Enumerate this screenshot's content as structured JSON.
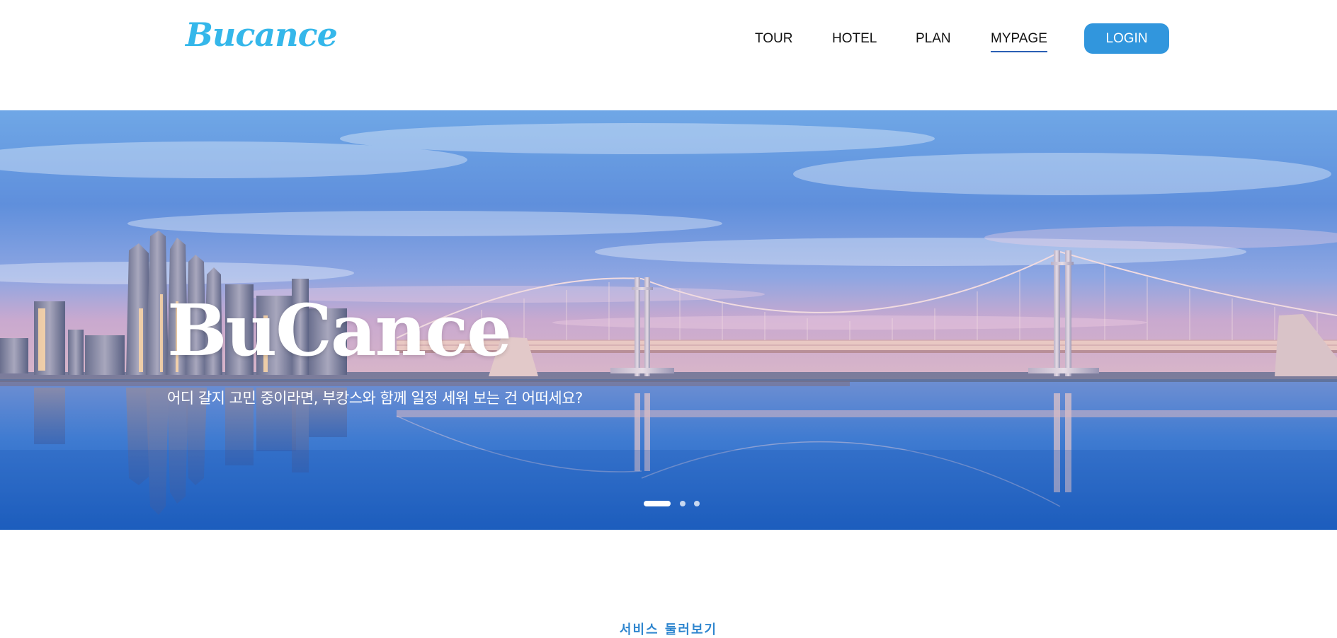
{
  "header": {
    "logo": "Bucance",
    "nav": [
      {
        "label": "TOUR",
        "active": false
      },
      {
        "label": "HOTEL",
        "active": false
      },
      {
        "label": "PLAN",
        "active": false
      },
      {
        "label": "MYPAGE",
        "active": true
      }
    ],
    "login_label": "LOGIN"
  },
  "hero": {
    "title": "BuCance",
    "subtitle": "어디 갈지 고민 중이라면, 부캉스와 함께 일정 세워 보는 건 어떠세요?",
    "slides": {
      "count": 3,
      "active": 0
    }
  },
  "section": {
    "label": "서비스 둘러보기"
  },
  "colors": {
    "brand": "#35b7ea",
    "login_button": "#3196dd",
    "nav_underline": "#2a5fb4",
    "section_label": "#2f86cf"
  }
}
